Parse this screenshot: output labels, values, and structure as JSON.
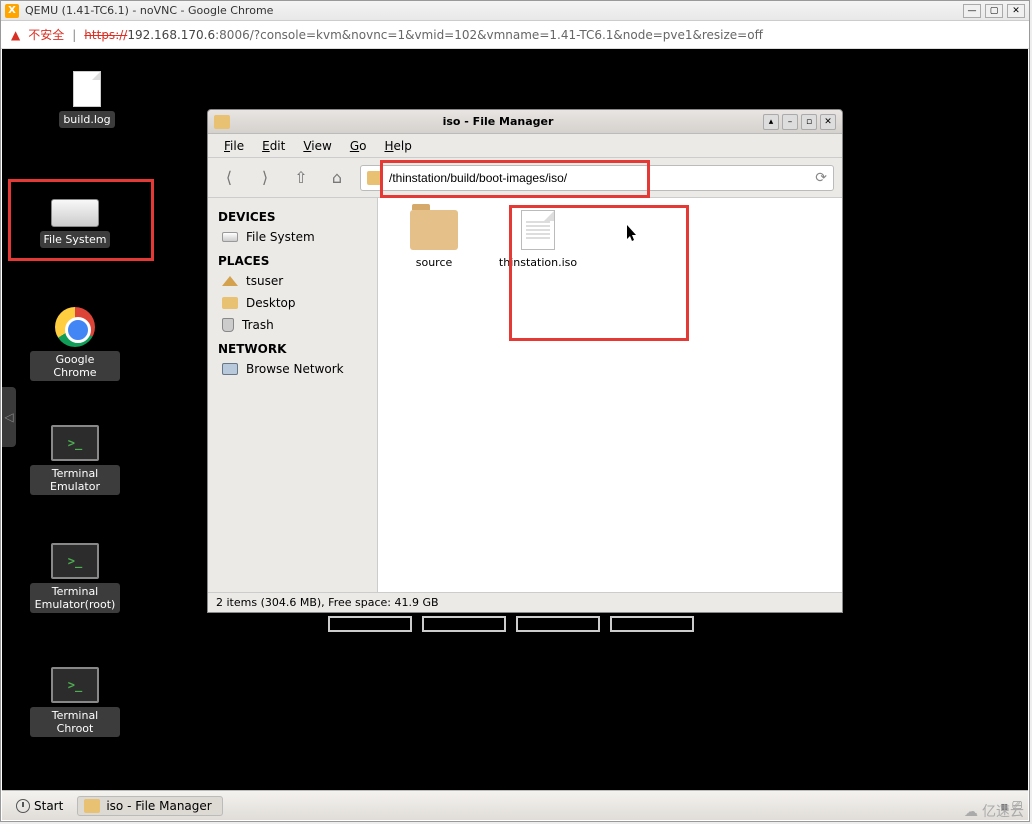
{
  "chrome": {
    "title": "QEMU (1.41-TC6.1) - noVNC - Google Chrome",
    "insecure_label": "不安全",
    "url_scheme": "https",
    "url_host": "192.168.170.6",
    "url_port": ":8006",
    "url_path": "/?console=kvm&novnc=1&vmid=102&vmname=1.41-TC6.1&node=pve1&resize=off"
  },
  "desktop": {
    "icons": [
      {
        "label": "build.log"
      },
      {
        "label": "File System"
      },
      {
        "label": "Google Chrome"
      },
      {
        "label": "Terminal Emulator"
      },
      {
        "label": "Terminal Emulator(root)"
      },
      {
        "label": "Terminal Chroot"
      }
    ]
  },
  "fm": {
    "title": "iso - File Manager",
    "menus": [
      "File",
      "Edit",
      "View",
      "Go",
      "Help"
    ],
    "path": "/thinstation/build/boot-images/iso/",
    "side": {
      "devices_hdr": "DEVICES",
      "devices": [
        "File System"
      ],
      "places_hdr": "PLACES",
      "places": [
        "tsuser",
        "Desktop",
        "Trash"
      ],
      "network_hdr": "NETWORK",
      "network": [
        "Browse Network"
      ]
    },
    "items": [
      {
        "label": "source"
      },
      {
        "label": "thinstation.iso"
      }
    ],
    "status": "2 items (304.6 MB), Free space: 41.9 GB"
  },
  "taskbar": {
    "start": "Start",
    "tasks": [
      "iso - File Manager"
    ]
  },
  "watermark": "亿速云"
}
